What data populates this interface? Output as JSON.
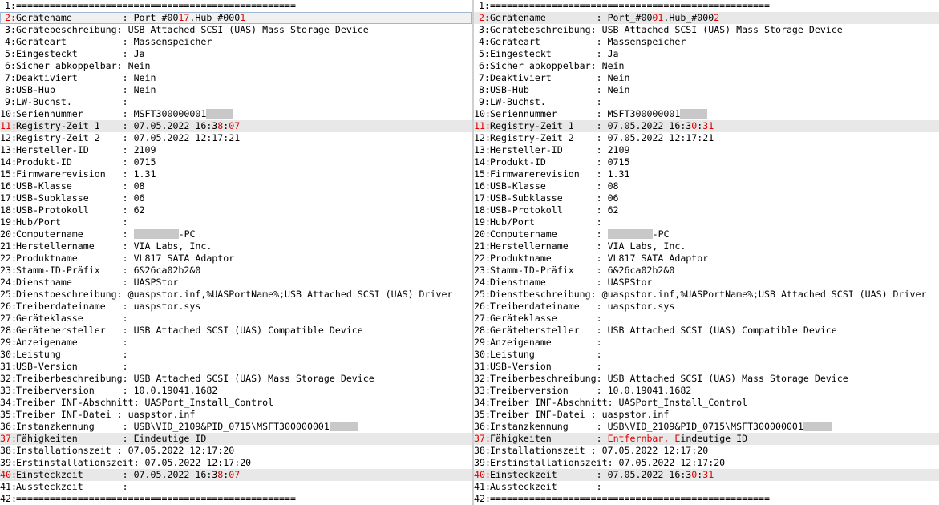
{
  "colors": {
    "diff_text": "#e00000",
    "diff_row_bg": "#e8e8e8",
    "redaction": "#c8c8c8"
  },
  "left": {
    "rows": [
      {
        "n": "1:",
        "s": [
          {
            "t": "=================================================="
          }
        ]
      },
      {
        "n": "2:",
        "diff": true,
        "current": true,
        "s": [
          {
            "t": "Gerätename         : Port #00"
          },
          {
            "t": "17",
            "h": true
          },
          {
            "t": ".Hub #000"
          },
          {
            "t": "1",
            "h": true
          }
        ]
      },
      {
        "n": "3:",
        "s": [
          {
            "t": "Gerätebeschreibung: USB Attached SCSI (UAS) Mass Storage Device"
          }
        ]
      },
      {
        "n": "4:",
        "s": [
          {
            "t": "Geräteart          : Massenspeicher"
          }
        ]
      },
      {
        "n": "5:",
        "s": [
          {
            "t": "Eingesteckt        : Ja"
          }
        ]
      },
      {
        "n": "6:",
        "s": [
          {
            "t": "Sicher abkoppelbar: Nein"
          }
        ]
      },
      {
        "n": "7:",
        "s": [
          {
            "t": "Deaktiviert        : Nein"
          }
        ]
      },
      {
        "n": "8:",
        "s": [
          {
            "t": "USB-Hub            : Nein"
          }
        ]
      },
      {
        "n": "9:",
        "s": [
          {
            "t": "LW-Buchst.         :"
          }
        ]
      },
      {
        "n": "10:",
        "s": [
          {
            "t": "Seriennummer       : MSFT300000001"
          },
          {
            "r": 34
          }
        ]
      },
      {
        "n": "11:",
        "diff": true,
        "s": [
          {
            "t": "Registry-Zeit 1    : 07.05.2022 16:3"
          },
          {
            "t": "8",
            "h": true
          },
          {
            "t": ":"
          },
          {
            "t": "07",
            "h": true
          }
        ]
      },
      {
        "n": "12:",
        "s": [
          {
            "t": "Registry-Zeit 2    : 07.05.2022 12:17:21"
          }
        ]
      },
      {
        "n": "13:",
        "s": [
          {
            "t": "Hersteller-ID      : 2109"
          }
        ]
      },
      {
        "n": "14:",
        "s": [
          {
            "t": "Produkt-ID         : 0715"
          }
        ]
      },
      {
        "n": "15:",
        "s": [
          {
            "t": "Firmwarerevision   : 1.31"
          }
        ]
      },
      {
        "n": "16:",
        "s": [
          {
            "t": "USB-Klasse         : 08"
          }
        ]
      },
      {
        "n": "17:",
        "s": [
          {
            "t": "USB-Subklasse      : 06"
          }
        ]
      },
      {
        "n": "18:",
        "s": [
          {
            "t": "USB-Protokoll      : 62"
          }
        ]
      },
      {
        "n": "19:",
        "s": [
          {
            "t": "Hub/Port           :"
          }
        ]
      },
      {
        "n": "20:",
        "s": [
          {
            "t": "Computername       : "
          },
          {
            "r": 56
          },
          {
            "t": "-PC"
          }
        ]
      },
      {
        "n": "21:",
        "s": [
          {
            "t": "Herstellername     : VIA Labs, Inc."
          }
        ]
      },
      {
        "n": "22:",
        "s": [
          {
            "t": "Produktname        : VL817 SATA Adaptor"
          }
        ]
      },
      {
        "n": "23:",
        "s": [
          {
            "t": "Stamm-ID-Präfix    : 6&26ca02b2&0"
          }
        ]
      },
      {
        "n": "24:",
        "s": [
          {
            "t": "Dienstname         : UASPStor"
          }
        ]
      },
      {
        "n": "25:",
        "s": [
          {
            "t": "Dienstbeschreibung: @uaspstor.inf,%UASPortName%;USB Attached SCSI (UAS) Driver"
          }
        ]
      },
      {
        "n": "26:",
        "s": [
          {
            "t": "Treiberdateiname   : uaspstor.sys"
          }
        ]
      },
      {
        "n": "27:",
        "s": [
          {
            "t": "Geräteklasse       :"
          }
        ]
      },
      {
        "n": "28:",
        "s": [
          {
            "t": "Gerätehersteller   : USB Attached SCSI (UAS) Compatible Device"
          }
        ]
      },
      {
        "n": "29:",
        "s": [
          {
            "t": "Anzeigename        :"
          }
        ]
      },
      {
        "n": "30:",
        "s": [
          {
            "t": "Leistung           :"
          }
        ]
      },
      {
        "n": "31:",
        "s": [
          {
            "t": "USB-Version        :"
          }
        ]
      },
      {
        "n": "32:",
        "s": [
          {
            "t": "Treiberbeschreibung: USB Attached SCSI (UAS) Mass Storage Device"
          }
        ]
      },
      {
        "n": "33:",
        "s": [
          {
            "t": "Treiberversion     : 10.0.19041.1682"
          }
        ]
      },
      {
        "n": "34:",
        "s": [
          {
            "t": "Treiber INF-Abschnitt: UASPort_Install_Control"
          }
        ]
      },
      {
        "n": "35:",
        "s": [
          {
            "t": "Treiber INF-Datei : uaspstor.inf"
          }
        ]
      },
      {
        "n": "36:",
        "s": [
          {
            "t": "Instanzkennung     : USB\\VID_2109&PID_0715\\MSFT300000001"
          },
          {
            "r": 36
          }
        ]
      },
      {
        "n": "37:",
        "diff": true,
        "s": [
          {
            "t": "Fähigkeiten        : Eindeutige ID"
          }
        ]
      },
      {
        "n": "38:",
        "s": [
          {
            "t": "Installationszeit : 07.05.2022 12:17:20"
          }
        ]
      },
      {
        "n": "39:",
        "s": [
          {
            "t": "Erstinstallationszeit: 07.05.2022 12:17:20"
          }
        ]
      },
      {
        "n": "40:",
        "diff": true,
        "s": [
          {
            "t": "Einsteckzeit       : 07.05.2022 16:3"
          },
          {
            "t": "8",
            "h": true
          },
          {
            "t": ":"
          },
          {
            "t": "07",
            "h": true
          }
        ]
      },
      {
        "n": "41:",
        "s": [
          {
            "t": "Aussteckzeit       :"
          }
        ]
      },
      {
        "n": "42:",
        "s": [
          {
            "t": "=================================================="
          }
        ]
      }
    ]
  },
  "right": {
    "rows": [
      {
        "n": "1:",
        "s": [
          {
            "t": "=================================================="
          }
        ]
      },
      {
        "n": "2:",
        "diff": true,
        "s": [
          {
            "t": "Gerätename         : Port_#00"
          },
          {
            "t": "01",
            "h": true
          },
          {
            "t": ".Hub_#000"
          },
          {
            "t": "2",
            "h": true
          }
        ]
      },
      {
        "n": "3:",
        "s": [
          {
            "t": "Gerätebeschreibung: USB Attached SCSI (UAS) Mass Storage Device"
          }
        ]
      },
      {
        "n": "4:",
        "s": [
          {
            "t": "Geräteart          : Massenspeicher"
          }
        ]
      },
      {
        "n": "5:",
        "s": [
          {
            "t": "Eingesteckt        : Ja"
          }
        ]
      },
      {
        "n": "6:",
        "s": [
          {
            "t": "Sicher abkoppelbar: Nein"
          }
        ]
      },
      {
        "n": "7:",
        "s": [
          {
            "t": "Deaktiviert        : Nein"
          }
        ]
      },
      {
        "n": "8:",
        "s": [
          {
            "t": "USB-Hub            : Nein"
          }
        ]
      },
      {
        "n": "9:",
        "s": [
          {
            "t": "LW-Buchst.         :"
          }
        ]
      },
      {
        "n": "10:",
        "s": [
          {
            "t": "Seriennummer       : MSFT300000001"
          },
          {
            "r": 34
          }
        ]
      },
      {
        "n": "11:",
        "diff": true,
        "s": [
          {
            "t": "Registry-Zeit 1    : 07.05.2022 16:3"
          },
          {
            "t": "0",
            "h": true
          },
          {
            "t": ":"
          },
          {
            "t": "31",
            "h": true
          }
        ]
      },
      {
        "n": "12:",
        "s": [
          {
            "t": "Registry-Zeit 2    : 07.05.2022 12:17:21"
          }
        ]
      },
      {
        "n": "13:",
        "s": [
          {
            "t": "Hersteller-ID      : 2109"
          }
        ]
      },
      {
        "n": "14:",
        "s": [
          {
            "t": "Produkt-ID         : 0715"
          }
        ]
      },
      {
        "n": "15:",
        "s": [
          {
            "t": "Firmwarerevision   : 1.31"
          }
        ]
      },
      {
        "n": "16:",
        "s": [
          {
            "t": "USB-Klasse         : 08"
          }
        ]
      },
      {
        "n": "17:",
        "s": [
          {
            "t": "USB-Subklasse      : 06"
          }
        ]
      },
      {
        "n": "18:",
        "s": [
          {
            "t": "USB-Protokoll      : 62"
          }
        ]
      },
      {
        "n": "19:",
        "s": [
          {
            "t": "Hub/Port           :"
          }
        ]
      },
      {
        "n": "20:",
        "s": [
          {
            "t": "Computername       : "
          },
          {
            "r": 56
          },
          {
            "t": "-PC"
          }
        ]
      },
      {
        "n": "21:",
        "s": [
          {
            "t": "Herstellername     : VIA Labs, Inc."
          }
        ]
      },
      {
        "n": "22:",
        "s": [
          {
            "t": "Produktname        : VL817 SATA Adaptor"
          }
        ]
      },
      {
        "n": "23:",
        "s": [
          {
            "t": "Stamm-ID-Präfix    : 6&26ca02b2&0"
          }
        ]
      },
      {
        "n": "24:",
        "s": [
          {
            "t": "Dienstname         : UASPStor"
          }
        ]
      },
      {
        "n": "25:",
        "s": [
          {
            "t": "Dienstbeschreibung: @uaspstor.inf,%UASPortName%;USB Attached SCSI (UAS) Driver"
          }
        ]
      },
      {
        "n": "26:",
        "s": [
          {
            "t": "Treiberdateiname   : uaspstor.sys"
          }
        ]
      },
      {
        "n": "27:",
        "s": [
          {
            "t": "Geräteklasse       :"
          }
        ]
      },
      {
        "n": "28:",
        "s": [
          {
            "t": "Gerätehersteller   : USB Attached SCSI (UAS) Compatible Device"
          }
        ]
      },
      {
        "n": "29:",
        "s": [
          {
            "t": "Anzeigename        :"
          }
        ]
      },
      {
        "n": "30:",
        "s": [
          {
            "t": "Leistung           :"
          }
        ]
      },
      {
        "n": "31:",
        "s": [
          {
            "t": "USB-Version        :"
          }
        ]
      },
      {
        "n": "32:",
        "s": [
          {
            "t": "Treiberbeschreibung: USB Attached SCSI (UAS) Mass Storage Device"
          }
        ]
      },
      {
        "n": "33:",
        "s": [
          {
            "t": "Treiberversion     : 10.0.19041.1682"
          }
        ]
      },
      {
        "n": "34:",
        "s": [
          {
            "t": "Treiber INF-Abschnitt: UASPort_Install_Control"
          }
        ]
      },
      {
        "n": "35:",
        "s": [
          {
            "t": "Treiber INF-Datei : uaspstor.inf"
          }
        ]
      },
      {
        "n": "36:",
        "s": [
          {
            "t": "Instanzkennung     : USB\\VID_2109&PID_0715\\MSFT300000001"
          },
          {
            "r": 36
          }
        ]
      },
      {
        "n": "37:",
        "diff": true,
        "s": [
          {
            "t": "Fähigkeiten        : "
          },
          {
            "t": "Entfernbar, E",
            "h": true
          },
          {
            "t": "indeutige ID"
          }
        ]
      },
      {
        "n": "38:",
        "s": [
          {
            "t": "Installationszeit : 07.05.2022 12:17:20"
          }
        ]
      },
      {
        "n": "39:",
        "s": [
          {
            "t": "Erstinstallationszeit: 07.05.2022 12:17:20"
          }
        ]
      },
      {
        "n": "40:",
        "diff": true,
        "s": [
          {
            "t": "Einsteckzeit       : 07.05.2022 16:3"
          },
          {
            "t": "0",
            "h": true
          },
          {
            "t": ":"
          },
          {
            "t": "31",
            "h": true
          }
        ]
      },
      {
        "n": "41:",
        "s": [
          {
            "t": "Aussteckzeit       :"
          }
        ]
      },
      {
        "n": "42:",
        "s": [
          {
            "t": "=================================================="
          }
        ]
      }
    ]
  }
}
